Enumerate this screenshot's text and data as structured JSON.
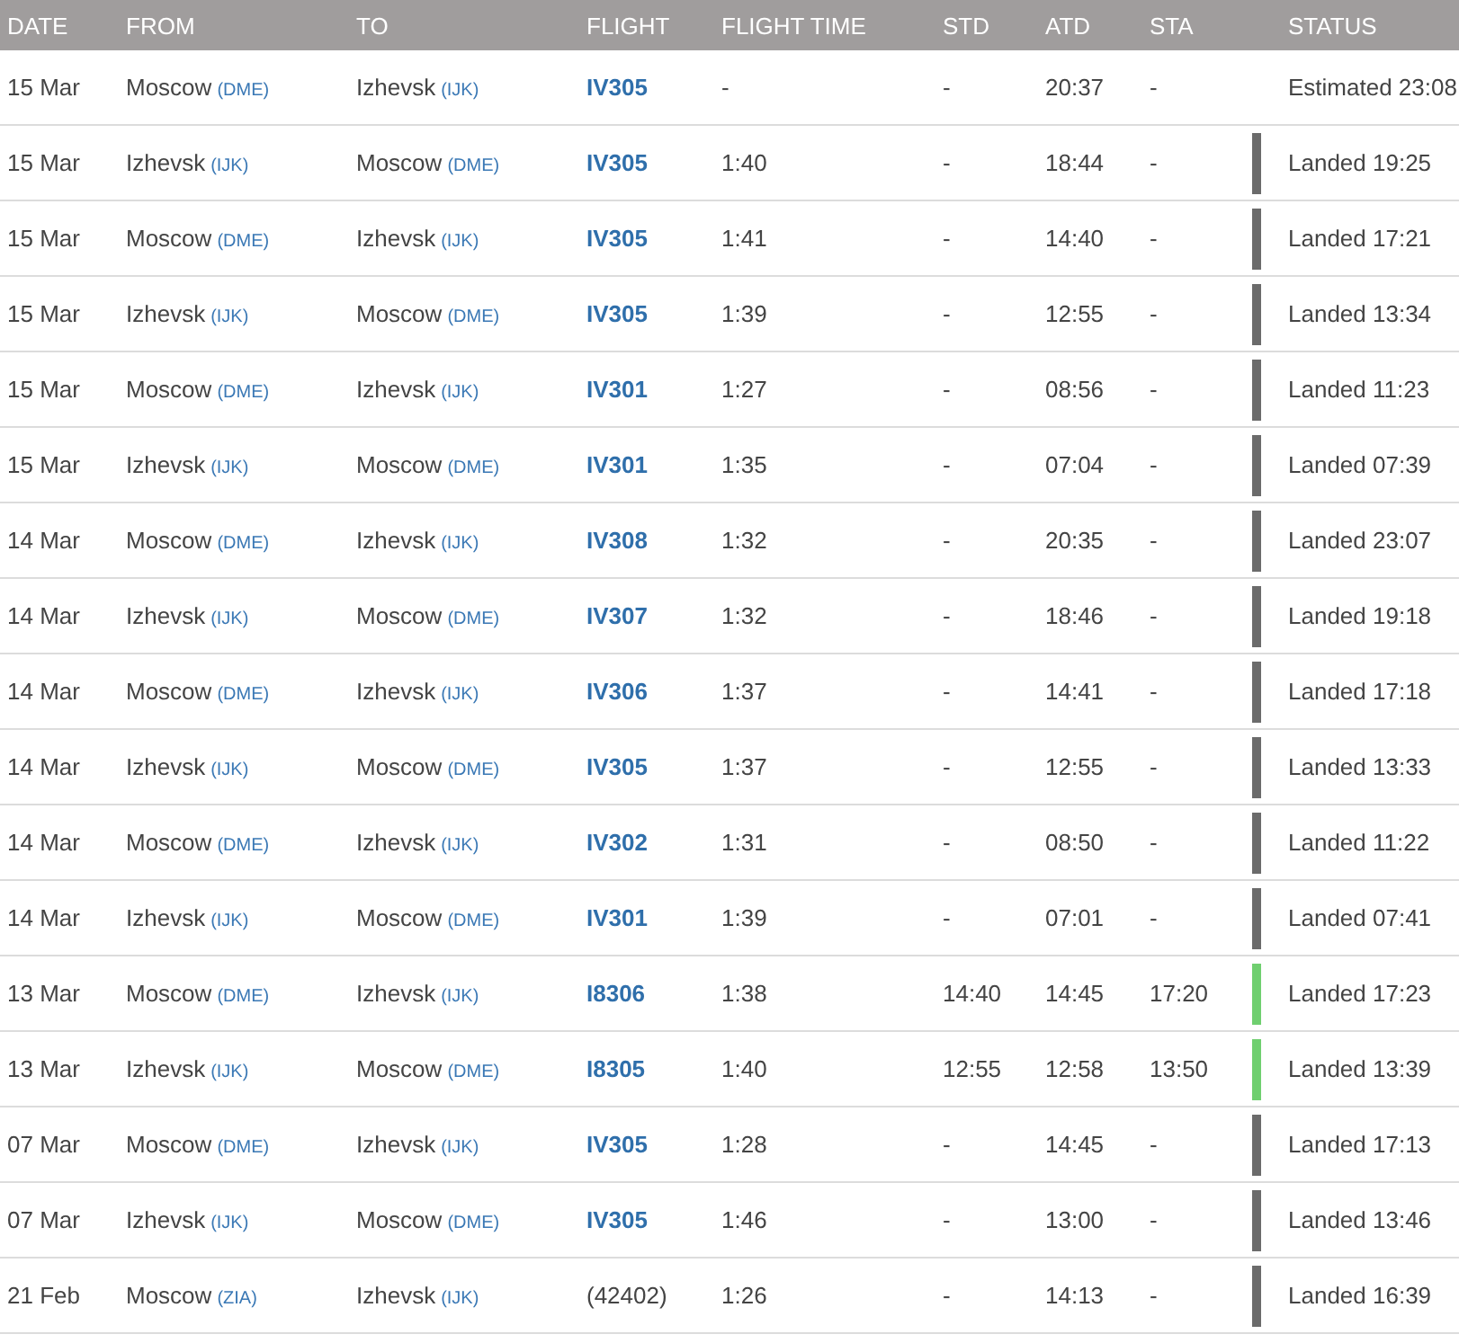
{
  "table": {
    "columns": [
      "DATE",
      "FROM",
      "TO",
      "FLIGHT",
      "FLIGHT TIME",
      "STD",
      "ATD",
      "STA",
      "STATUS"
    ],
    "rows": [
      {
        "date": "15 Mar",
        "from": {
          "city": "Moscow",
          "code": "(DME)"
        },
        "to": {
          "city": "Izhevsk",
          "code": "(IJK)"
        },
        "flight": {
          "text": "IV305",
          "kind": "link"
        },
        "flight_time": "-",
        "std": "-",
        "atd": "20:37",
        "sta": "-",
        "status": {
          "text": "Estimated 23:08"
        }
      },
      {
        "date": "15 Mar",
        "from": {
          "city": "Izhevsk",
          "code": "(IJK)"
        },
        "to": {
          "city": "Moscow",
          "code": "(DME)"
        },
        "flight": {
          "text": "IV305",
          "kind": "link"
        },
        "flight_time": "1:40",
        "std": "-",
        "atd": "18:44",
        "sta": "-",
        "status": {
          "text": "Landed 19:25",
          "color": "#6b6b6b"
        }
      },
      {
        "date": "15 Mar",
        "from": {
          "city": "Moscow",
          "code": "(DME)"
        },
        "to": {
          "city": "Izhevsk",
          "code": "(IJK)"
        },
        "flight": {
          "text": "IV305",
          "kind": "link"
        },
        "flight_time": "1:41",
        "std": "-",
        "atd": "14:40",
        "sta": "-",
        "status": {
          "text": "Landed 17:21",
          "color": "#6b6b6b"
        }
      },
      {
        "date": "15 Mar",
        "from": {
          "city": "Izhevsk",
          "code": "(IJK)"
        },
        "to": {
          "city": "Moscow",
          "code": "(DME)"
        },
        "flight": {
          "text": "IV305",
          "kind": "link"
        },
        "flight_time": "1:39",
        "std": "-",
        "atd": "12:55",
        "sta": "-",
        "status": {
          "text": "Landed 13:34",
          "color": "#6b6b6b"
        }
      },
      {
        "date": "15 Mar",
        "from": {
          "city": "Moscow",
          "code": "(DME)"
        },
        "to": {
          "city": "Izhevsk",
          "code": "(IJK)"
        },
        "flight": {
          "text": "IV301",
          "kind": "link"
        },
        "flight_time": "1:27",
        "std": "-",
        "atd": "08:56",
        "sta": "-",
        "status": {
          "text": "Landed 11:23",
          "color": "#6b6b6b"
        }
      },
      {
        "date": "15 Mar",
        "from": {
          "city": "Izhevsk",
          "code": "(IJK)"
        },
        "to": {
          "city": "Moscow",
          "code": "(DME)"
        },
        "flight": {
          "text": "IV301",
          "kind": "link"
        },
        "flight_time": "1:35",
        "std": "-",
        "atd": "07:04",
        "sta": "-",
        "status": {
          "text": "Landed 07:39",
          "color": "#6b6b6b"
        }
      },
      {
        "date": "14 Mar",
        "from": {
          "city": "Moscow",
          "code": "(DME)"
        },
        "to": {
          "city": "Izhevsk",
          "code": "(IJK)"
        },
        "flight": {
          "text": "IV308",
          "kind": "link"
        },
        "flight_time": "1:32",
        "std": "-",
        "atd": "20:35",
        "sta": "-",
        "status": {
          "text": "Landed 23:07",
          "color": "#6b6b6b"
        }
      },
      {
        "date": "14 Mar",
        "from": {
          "city": "Izhevsk",
          "code": "(IJK)"
        },
        "to": {
          "city": "Moscow",
          "code": "(DME)"
        },
        "flight": {
          "text": "IV307",
          "kind": "link"
        },
        "flight_time": "1:32",
        "std": "-",
        "atd": "18:46",
        "sta": "-",
        "status": {
          "text": "Landed 19:18",
          "color": "#6b6b6b"
        }
      },
      {
        "date": "14 Mar",
        "from": {
          "city": "Moscow",
          "code": "(DME)"
        },
        "to": {
          "city": "Izhevsk",
          "code": "(IJK)"
        },
        "flight": {
          "text": "IV306",
          "kind": "link"
        },
        "flight_time": "1:37",
        "std": "-",
        "atd": "14:41",
        "sta": "-",
        "status": {
          "text": "Landed 17:18",
          "color": "#6b6b6b"
        }
      },
      {
        "date": "14 Mar",
        "from": {
          "city": "Izhevsk",
          "code": "(IJK)"
        },
        "to": {
          "city": "Moscow",
          "code": "(DME)"
        },
        "flight": {
          "text": "IV305",
          "kind": "link"
        },
        "flight_time": "1:37",
        "std": "-",
        "atd": "12:55",
        "sta": "-",
        "status": {
          "text": "Landed 13:33",
          "color": "#6b6b6b"
        }
      },
      {
        "date": "14 Mar",
        "from": {
          "city": "Moscow",
          "code": "(DME)"
        },
        "to": {
          "city": "Izhevsk",
          "code": "(IJK)"
        },
        "flight": {
          "text": "IV302",
          "kind": "link"
        },
        "flight_time": "1:31",
        "std": "-",
        "atd": "08:50",
        "sta": "-",
        "status": {
          "text": "Landed 11:22",
          "color": "#6b6b6b"
        }
      },
      {
        "date": "14 Mar",
        "from": {
          "city": "Izhevsk",
          "code": "(IJK)"
        },
        "to": {
          "city": "Moscow",
          "code": "(DME)"
        },
        "flight": {
          "text": "IV301",
          "kind": "link"
        },
        "flight_time": "1:39",
        "std": "-",
        "atd": "07:01",
        "sta": "-",
        "status": {
          "text": "Landed 07:41",
          "color": "#6b6b6b"
        }
      },
      {
        "date": "13 Mar",
        "from": {
          "city": "Moscow",
          "code": "(DME)"
        },
        "to": {
          "city": "Izhevsk",
          "code": "(IJK)"
        },
        "flight": {
          "text": "I8306",
          "kind": "link"
        },
        "flight_time": "1:38",
        "std": "14:40",
        "atd": "14:45",
        "sta": "17:20",
        "status": {
          "text": "Landed 17:23",
          "color": "#6fcf6f"
        }
      },
      {
        "date": "13 Mar",
        "from": {
          "city": "Izhevsk",
          "code": "(IJK)"
        },
        "to": {
          "city": "Moscow",
          "code": "(DME)"
        },
        "flight": {
          "text": "I8305",
          "kind": "link"
        },
        "flight_time": "1:40",
        "std": "12:55",
        "atd": "12:58",
        "sta": "13:50",
        "status": {
          "text": "Landed 13:39",
          "color": "#6fcf6f"
        }
      },
      {
        "date": "07 Mar",
        "from": {
          "city": "Moscow",
          "code": "(DME)"
        },
        "to": {
          "city": "Izhevsk",
          "code": "(IJK)"
        },
        "flight": {
          "text": "IV305",
          "kind": "link"
        },
        "flight_time": "1:28",
        "std": "-",
        "atd": "14:45",
        "sta": "-",
        "status": {
          "text": "Landed 17:13",
          "color": "#6b6b6b"
        }
      },
      {
        "date": "07 Mar",
        "from": {
          "city": "Izhevsk",
          "code": "(IJK)"
        },
        "to": {
          "city": "Moscow",
          "code": "(DME)"
        },
        "flight": {
          "text": "IV305",
          "kind": "link"
        },
        "flight_time": "1:46",
        "std": "-",
        "atd": "13:00",
        "sta": "-",
        "status": {
          "text": "Landed 13:46",
          "color": "#6b6b6b"
        }
      },
      {
        "date": "21 Feb",
        "from": {
          "city": "Moscow",
          "code": "(ZIA)"
        },
        "to": {
          "city": "Izhevsk",
          "code": "(IJK)"
        },
        "flight": {
          "text": "(42402)",
          "kind": "plain"
        },
        "flight_time": "1:26",
        "std": "-",
        "atd": "14:13",
        "sta": "-",
        "status": {
          "text": "Landed 16:39",
          "color": "#6b6b6b"
        }
      }
    ]
  }
}
